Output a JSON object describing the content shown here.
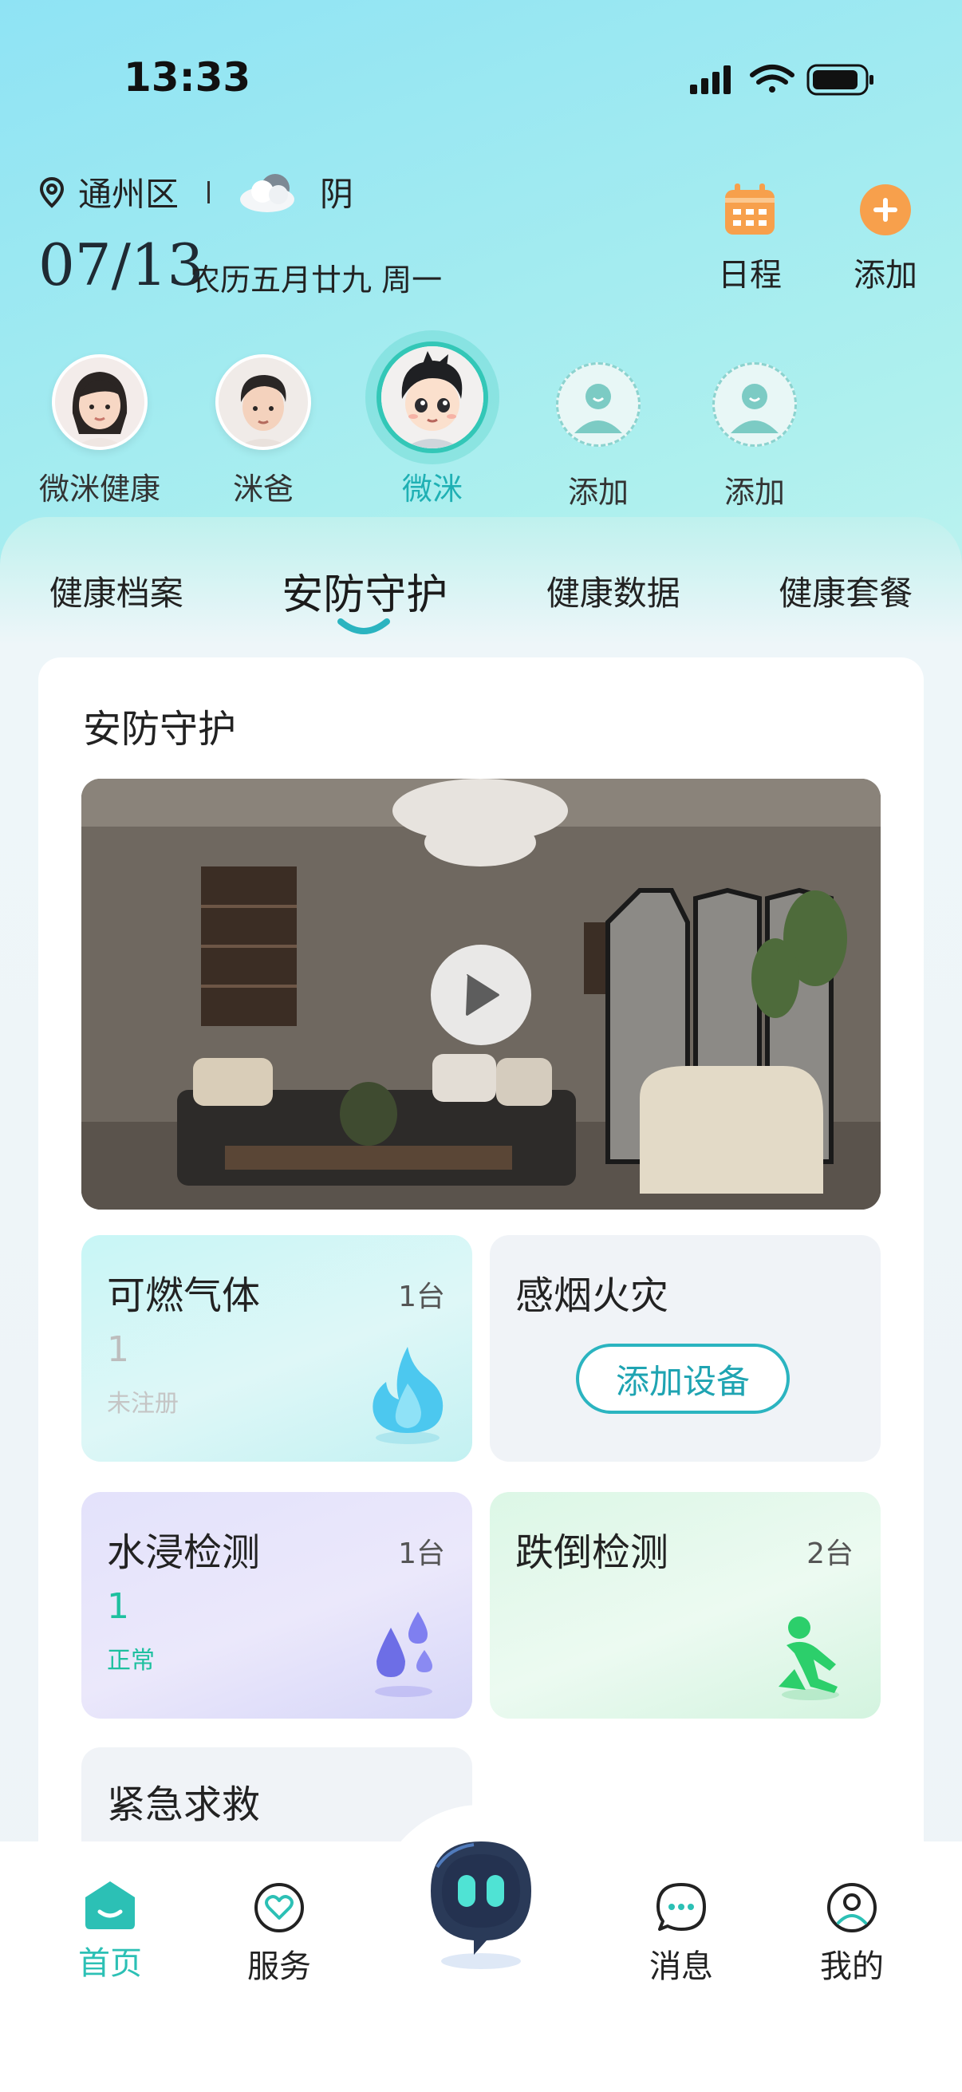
{
  "status": {
    "time": "13:33"
  },
  "header": {
    "location": "通州区",
    "weather": "阴",
    "date": "07/13",
    "lunar": "农历五月廿九 周一",
    "schedule_label": "日程",
    "add_label": "添加"
  },
  "members": [
    {
      "label": "微洣健康"
    },
    {
      "label": "洣爸"
    },
    {
      "label": "微洣"
    },
    {
      "label": "添加"
    },
    {
      "label": "添加"
    }
  ],
  "tabs": [
    "健康档案",
    "安防守护",
    "健康数据",
    "健康套餐"
  ],
  "section": {
    "title": "安防守护"
  },
  "tiles": {
    "gas": {
      "title": "可燃气体",
      "count": "1台",
      "value": "1",
      "status": "未注册"
    },
    "smoke": {
      "title": "感烟火灾",
      "button": "添加设备"
    },
    "water": {
      "title": "水浸检测",
      "count": "1台",
      "value": "1",
      "status": "正常"
    },
    "fall": {
      "title": "跌倒检测",
      "count": "2台"
    },
    "sos": {
      "title": "紧急求救"
    }
  },
  "nav": {
    "home": "首页",
    "service": "服务",
    "message": "消息",
    "mine": "我的"
  },
  "colors": {
    "accent": "#2cc0b5",
    "orange": "#f7a04c"
  }
}
